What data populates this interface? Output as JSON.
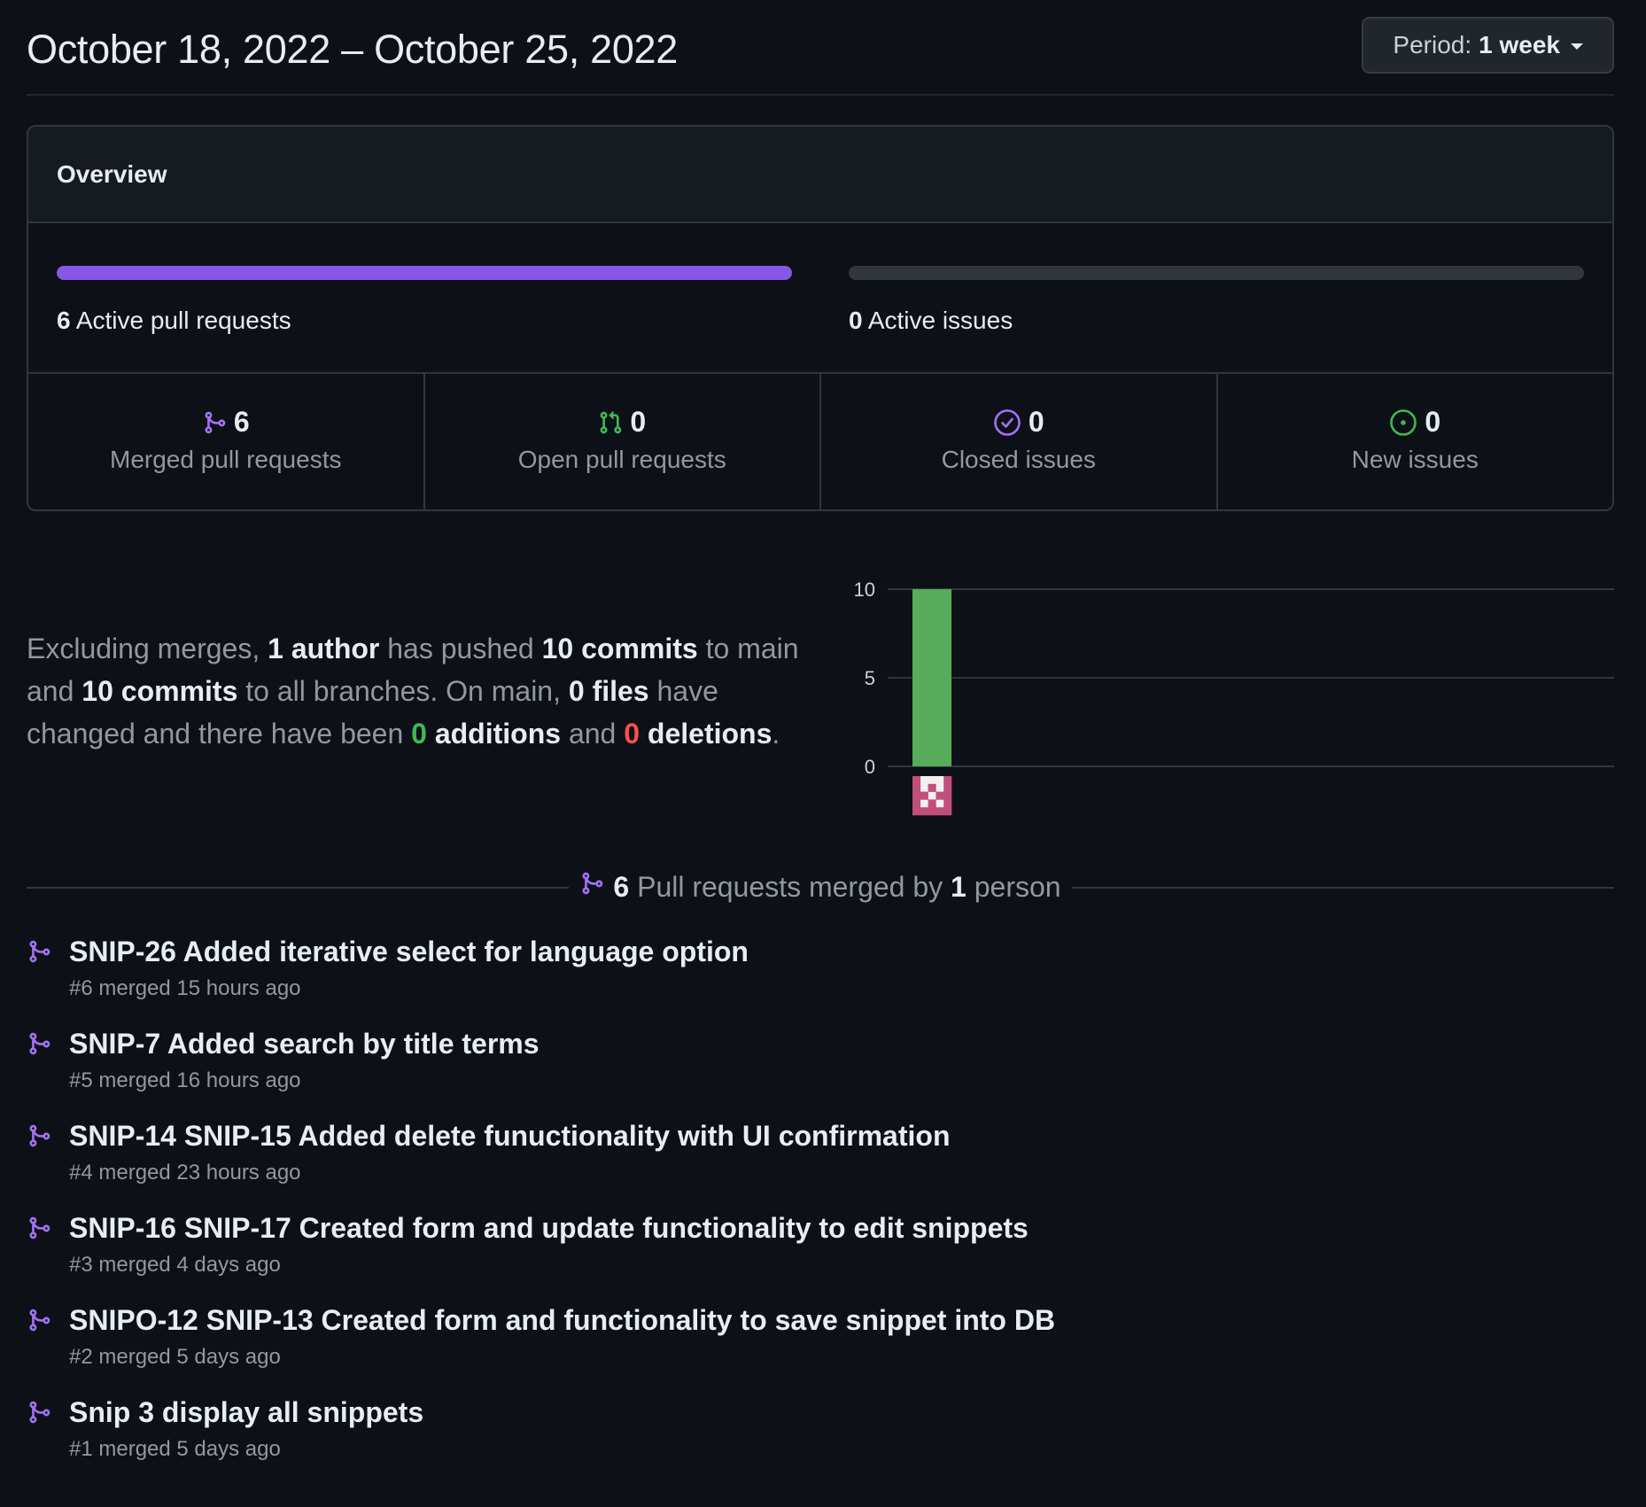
{
  "header": {
    "title": "October 18, 2022 – October 25, 2022",
    "period_label": "Period:",
    "period_value": "1 week"
  },
  "overview": {
    "heading": "Overview",
    "active_prs": {
      "count": "6",
      "label": "Active pull requests",
      "fill_fraction": 1.0,
      "color": "#8957e5"
    },
    "active_issues": {
      "count": "0",
      "label": "Active issues",
      "fill_fraction": 0.0
    },
    "stats": [
      {
        "icon": "git-merge-icon",
        "count": "6",
        "label": "Merged pull requests",
        "color": "#a371f7"
      },
      {
        "icon": "git-pull-request-icon",
        "count": "0",
        "label": "Open pull requests",
        "color": "#3fb950"
      },
      {
        "icon": "issue-closed-icon",
        "count": "0",
        "label": "Closed issues",
        "color": "#a371f7"
      },
      {
        "icon": "issue-opened-icon",
        "count": "0",
        "label": "New issues",
        "color": "#3fb950"
      }
    ]
  },
  "summary": {
    "t1": "Excluding merges, ",
    "authors": "1 author",
    "t2": " has pushed ",
    "commits_main": "10 commits",
    "t3": " to main and ",
    "commits_all": "10 commits",
    "t4": " to all branches. On main, ",
    "files": "0 files",
    "t5": " have changed and there have been ",
    "additions_num": "0",
    "additions_word": " additions",
    "t6": " and ",
    "deletions_num": "0",
    "deletions_word": " deletions",
    "t7": "."
  },
  "chart_data": {
    "type": "bar",
    "categories": [
      "author-avatar"
    ],
    "values": [
      10
    ],
    "yticks": [
      "10",
      "5",
      "0"
    ],
    "ylim": [
      0,
      10
    ],
    "bar_color": "#57ab5a"
  },
  "merged_section": {
    "count": "6",
    "text1": " Pull requests merged by ",
    "people": "1",
    "text2": " person"
  },
  "pull_requests": [
    {
      "title": "SNIP-26 Added iterative select for language option",
      "meta": "#6 merged 15 hours ago"
    },
    {
      "title": "SNIP-7 Added search by title terms",
      "meta": "#5 merged 16 hours ago"
    },
    {
      "title": "SNIP-14 SNIP-15 Added delete funuctionality with UI confirmation",
      "meta": "#4 merged 23 hours ago"
    },
    {
      "title": "SNIP-16 SNIP-17 Created form and update functionality to edit snippets",
      "meta": "#3 merged 4 days ago"
    },
    {
      "title": "SNIPO-12 SNIP-13 Created form and functionality to save snippet into DB",
      "meta": "#2 merged 5 days ago"
    },
    {
      "title": "Snip 3 display all snippets",
      "meta": "#1 merged 5 days ago"
    }
  ]
}
